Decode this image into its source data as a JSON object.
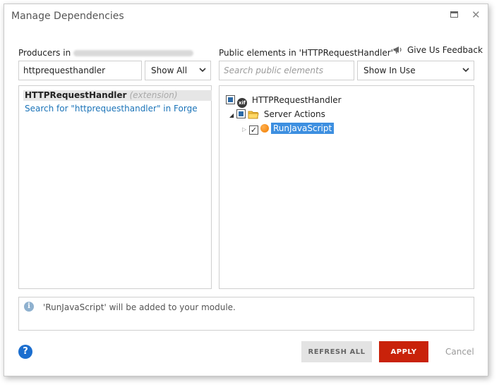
{
  "dialog": {
    "title": "Manage Dependencies"
  },
  "producers": {
    "label": "Producers in",
    "search_value": "httprequesthandler",
    "filter_selected": "Show All",
    "results": [
      {
        "name": "HTTPRequestHandler",
        "tag": "(extension)"
      }
    ],
    "forge_link": "Search for \"httprequesthandler\" in Forge"
  },
  "public_elements": {
    "label": "Public elements in 'HTTPRequestHandler'",
    "search_placeholder": "Search public elements",
    "filter_selected": "Show In Use",
    "tree": {
      "root": "HTTPRequestHandler",
      "root_icon_text": "xif",
      "folder": "Server Actions",
      "item": "RunJavaScript"
    }
  },
  "feedback_label": "Give Us Feedback",
  "info_message": "'RunJavaScript' will be added to your module.",
  "buttons": {
    "refresh_all": "REFRESH ALL",
    "apply": "APPLY",
    "cancel": "Cancel"
  },
  "colors": {
    "apply": "#c9220a",
    "selection": "#3d8fe0",
    "link": "#1a73b8",
    "help": "#1b6ecf"
  }
}
